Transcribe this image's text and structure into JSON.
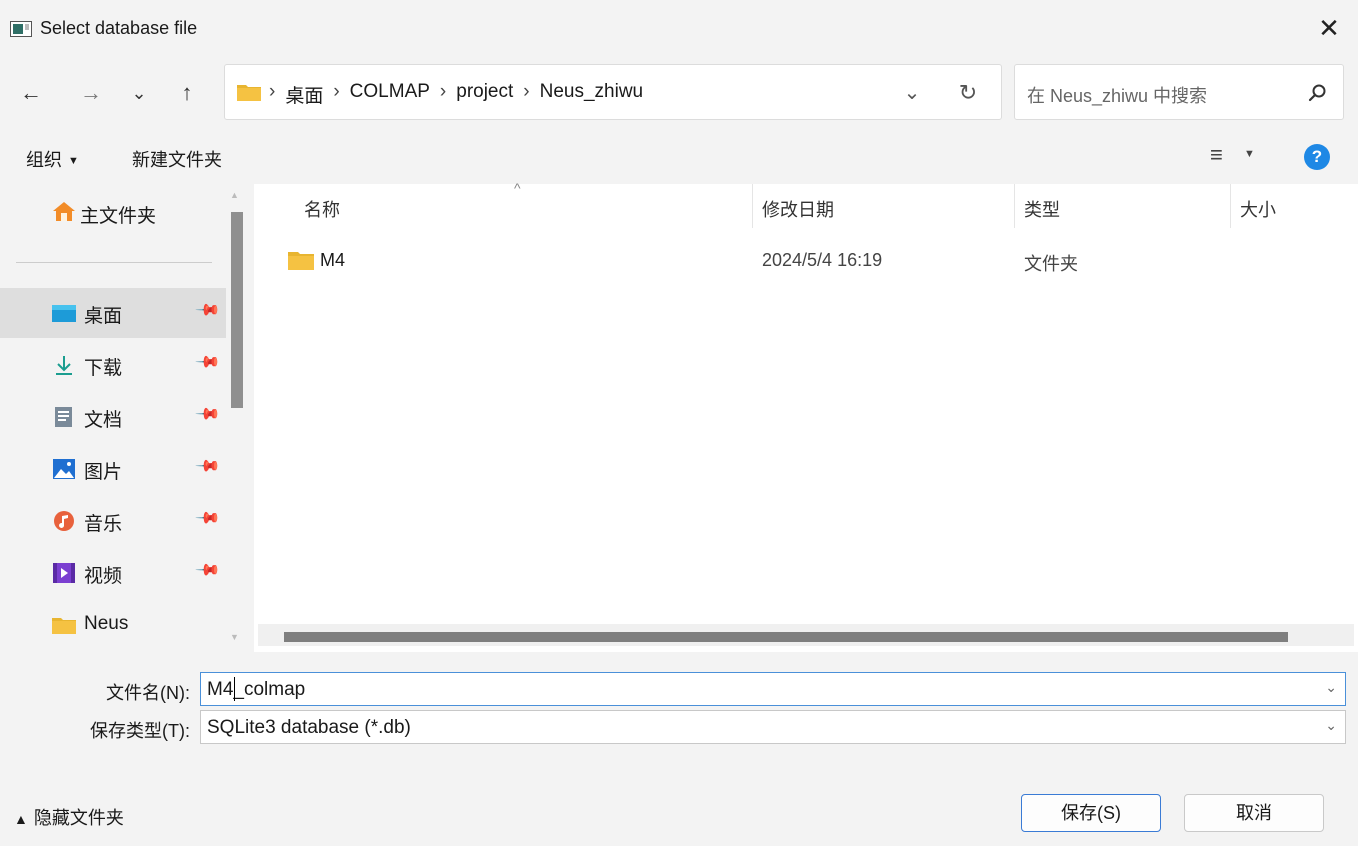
{
  "window": {
    "title": "Select database file",
    "close_label": "✕"
  },
  "nav": {
    "back": "←",
    "forward": "→",
    "recent": "⌄",
    "up": "↑",
    "breadcrumbs": [
      "桌面",
      "COLMAP",
      "project",
      "Neus_zhiwu"
    ],
    "separator": "›",
    "dropdown": "⌄",
    "refresh": "↻",
    "search_placeholder": "在 Neus_zhiwu 中搜索"
  },
  "toolbar": {
    "organize": "组织",
    "new_folder": "新建文件夹",
    "help": "?"
  },
  "sidebar": {
    "home": "主文件夹",
    "items": [
      {
        "label": "桌面",
        "icon": "desktop-icon",
        "pinned": true
      },
      {
        "label": "下载",
        "icon": "download-icon",
        "pinned": true
      },
      {
        "label": "文档",
        "icon": "document-icon",
        "pinned": true
      },
      {
        "label": "图片",
        "icon": "picture-icon",
        "pinned": true
      },
      {
        "label": "音乐",
        "icon": "music-icon",
        "pinned": true
      },
      {
        "label": "视频",
        "icon": "video-icon",
        "pinned": true
      },
      {
        "label": "Neus",
        "icon": "folder-icon",
        "pinned": false
      }
    ]
  },
  "columns": {
    "name": "名称",
    "modified": "修改日期",
    "type": "类型",
    "size": "大小"
  },
  "files": [
    {
      "name": "M4",
      "modified": "2024/5/4 16:19",
      "type": "文件夹",
      "size": ""
    }
  ],
  "form": {
    "filename_label": "文件名(N):",
    "filename_value": "M4_colmap",
    "filetype_label": "保存类型(T):",
    "filetype_value": "SQLite3 database (*.db)"
  },
  "footer": {
    "hide_folders": "隐藏文件夹",
    "save": "保存(S)",
    "cancel": "取消"
  },
  "colors": {
    "accent": "#1e88e5",
    "folder": "#f5c242",
    "selected": "#dedede"
  }
}
